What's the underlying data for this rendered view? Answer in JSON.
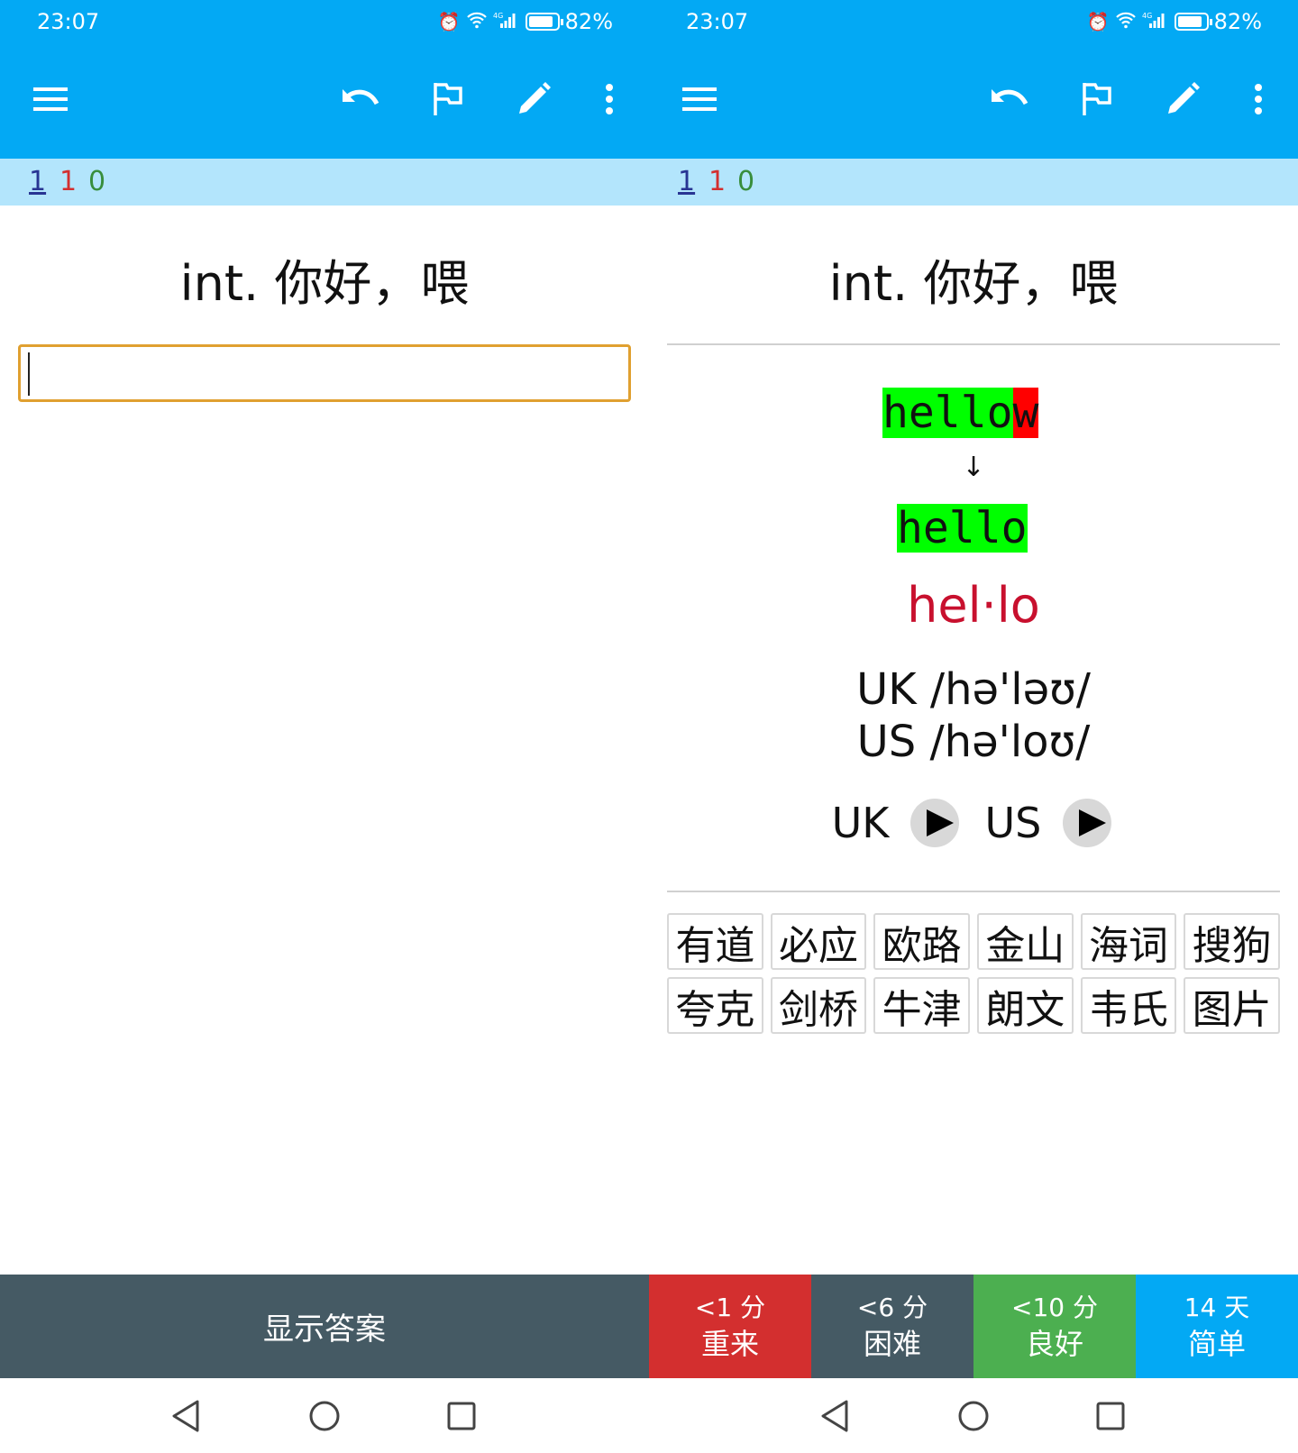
{
  "status": {
    "time": "23:07",
    "battery": "82%",
    "network": "4G"
  },
  "counts": {
    "new": "1",
    "learning": "1",
    "review": "0"
  },
  "card": {
    "question": "int. 你好，喂",
    "typed_ok": "hello",
    "typed_bad": "w",
    "arrow": "↓",
    "correct": "hello",
    "syllable": "hel·lo",
    "phonetic_uk": "UK /hə'ləʊ/",
    "phonetic_us": "US /hə'loʊ/",
    "audio_uk": "UK",
    "audio_us": "US"
  },
  "dictionaries": [
    "有道",
    "必应",
    "欧路",
    "金山",
    "海词",
    "搜狗",
    "夸克",
    "剑桥",
    "牛津",
    "朗文",
    "韦氏",
    "图片"
  ],
  "buttons": {
    "show_answer": "显示答案",
    "again_time": "<1 分",
    "again_label": "重来",
    "hard_time": "<6 分",
    "hard_label": "困难",
    "good_time": "<10 分",
    "good_label": "良好",
    "easy_time": "14 天",
    "easy_label": "简单"
  },
  "icons": [
    "menu-icon",
    "undo-icon",
    "flag-icon",
    "edit-icon",
    "more-icon",
    "back-icon",
    "home-icon",
    "recents-icon",
    "play-icon"
  ],
  "colors": {
    "toolbar": "#03a9f4",
    "count_bar": "#b3e5fc",
    "again": "#d32f2f",
    "hard": "#455a64",
    "good": "#4caf50",
    "easy": "#03a9f4",
    "correct_bg": "#00ff00",
    "wrong_bg": "#ff0000",
    "syllable": "#c8102e"
  }
}
